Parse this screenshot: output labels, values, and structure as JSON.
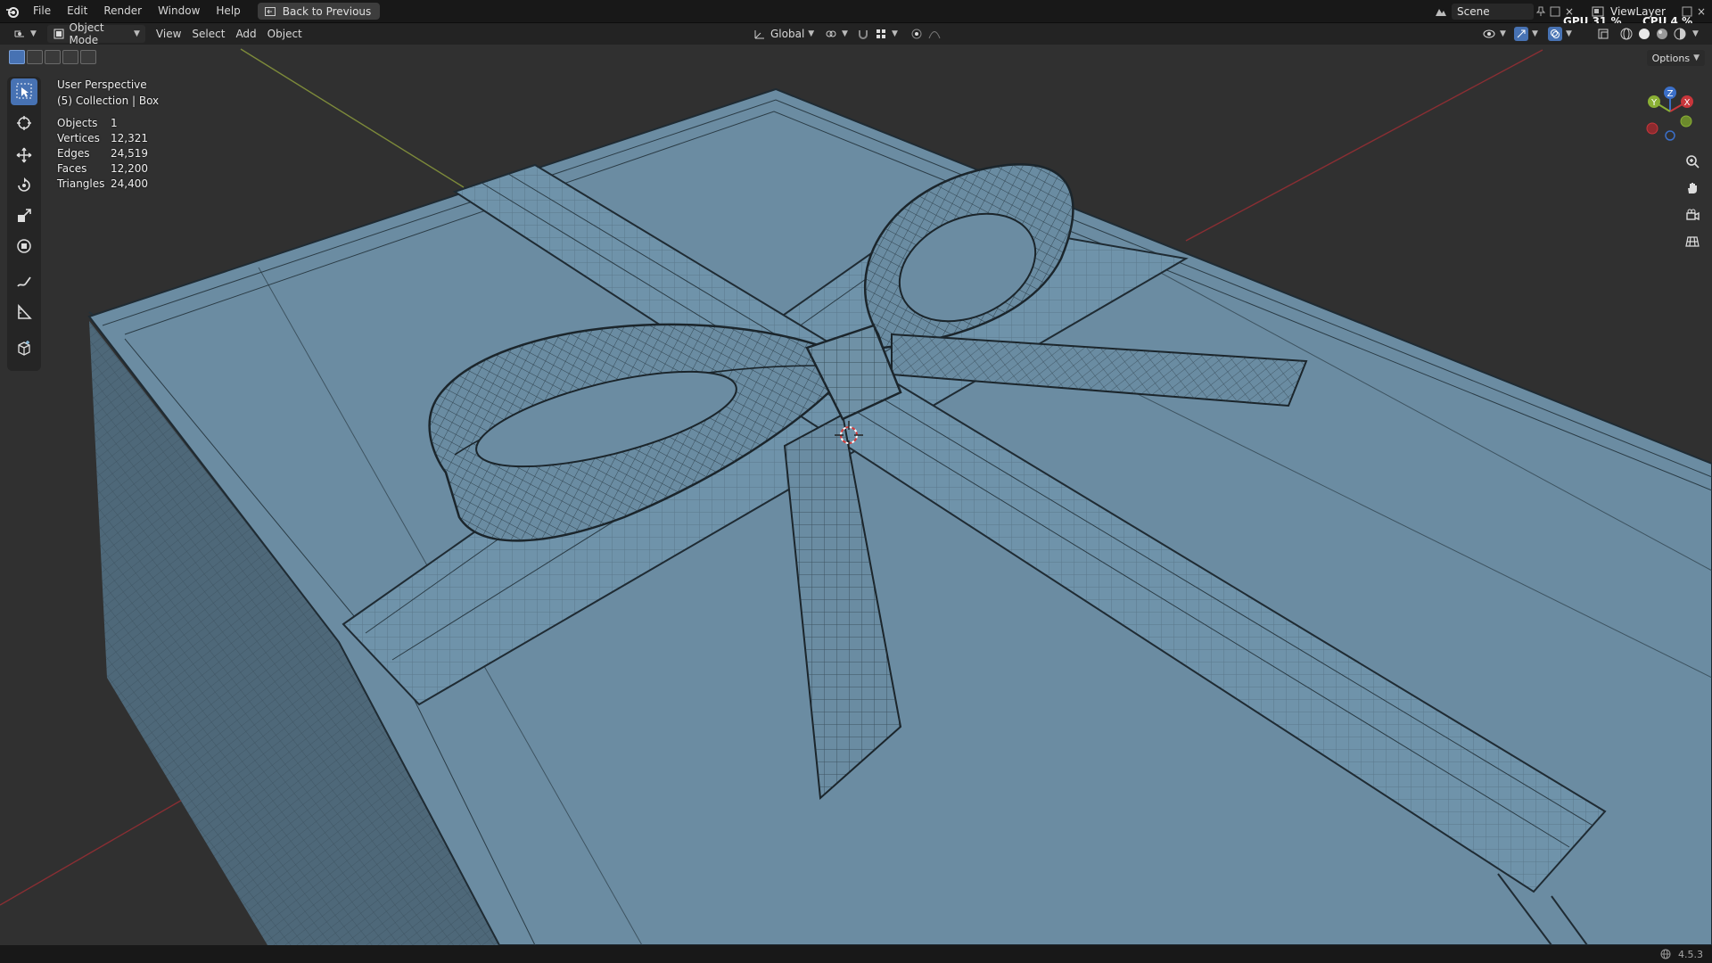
{
  "menu": {
    "items": [
      "File",
      "Edit",
      "Render",
      "Window",
      "Help"
    ],
    "back_label": "Back to Previous"
  },
  "top_right": {
    "scene": "Scene",
    "view_layer": "ViewLayer",
    "gpu_label": "GPU",
    "gpu_value": "31 %",
    "cpu_label": "CPU",
    "cpu_value": "4 %"
  },
  "header": {
    "mode": "Object Mode",
    "menus": [
      "View",
      "Select",
      "Add",
      "Object"
    ],
    "transform_orientation": "Global",
    "options_label": "Options"
  },
  "overlay": {
    "view_name": "User Perspective",
    "collection": "(5) Collection | Box",
    "stats": [
      {
        "label": "Objects",
        "value": "1"
      },
      {
        "label": "Vertices",
        "value": "12,321"
      },
      {
        "label": "Edges",
        "value": "24,519"
      },
      {
        "label": "Faces",
        "value": "12,200"
      },
      {
        "label": "Triangles",
        "value": "24,400"
      }
    ]
  },
  "gizmo": {
    "x": "X",
    "y": "Y",
    "z": "Z"
  },
  "status": {
    "version": "4.5.3"
  },
  "colors": {
    "accent": "#4772b3",
    "viewport_bg": "#303030",
    "mesh_fill": "#6b8ca2",
    "x_axis": "#c8363b",
    "y_axis": "#8bb035",
    "z_axis": "#3b6fc8"
  }
}
